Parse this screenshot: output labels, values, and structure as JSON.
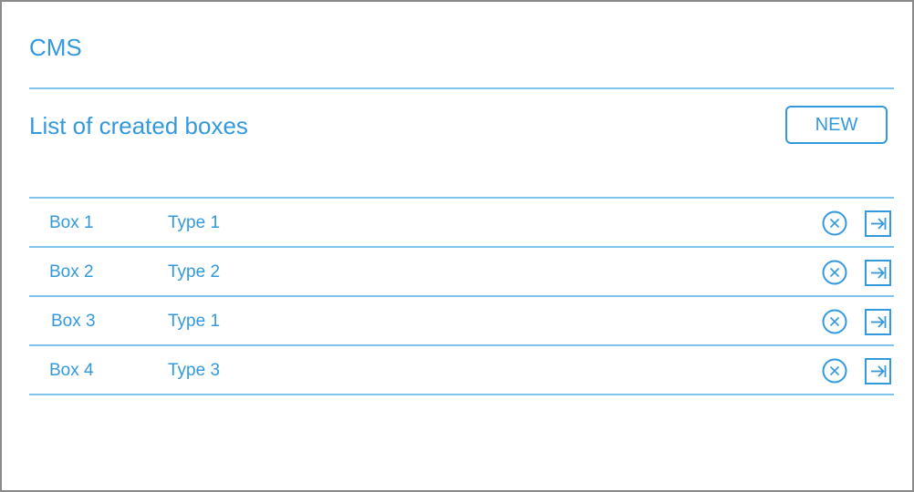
{
  "app": {
    "title": "CMS"
  },
  "section": {
    "title": "List of created boxes",
    "new_button_label": "NEW"
  },
  "boxes": [
    {
      "name": "Box 1",
      "type": "Type 1"
    },
    {
      "name": "Box 2",
      "type": "Type 2"
    },
    {
      "name": "Box 3",
      "type": "Type 1"
    },
    {
      "name": "Box 4",
      "type": "Type 3"
    }
  ],
  "icons": {
    "delete": "close-circle-icon",
    "open": "arrow-right-box-icon"
  },
  "colors": {
    "accent": "#3399dd",
    "divider": "#7ec3ee",
    "frame_border": "#8a8a8a"
  }
}
